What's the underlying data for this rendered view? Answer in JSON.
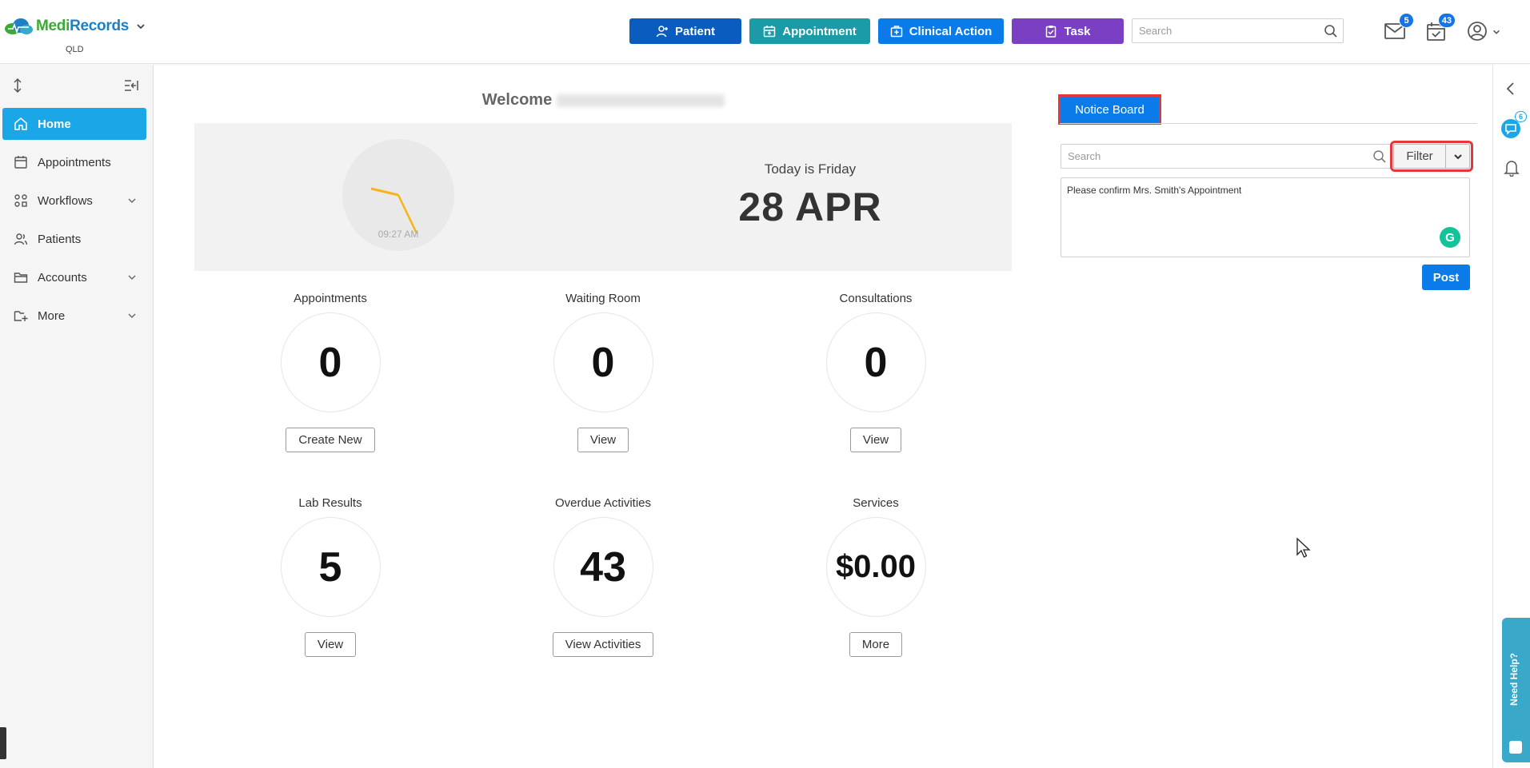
{
  "header": {
    "logo_text_a": "Medi",
    "logo_text_b": "Records",
    "location": "QLD",
    "buttons": {
      "patient": "Patient",
      "appointment": "Appointment",
      "clinical_action": "Clinical Action",
      "task": "Task"
    },
    "search_placeholder": "Search",
    "mail_badge": "5",
    "tasks_badge": "43"
  },
  "sidebar": {
    "items": [
      {
        "label": "Home",
        "icon": "home-icon"
      },
      {
        "label": "Appointments",
        "icon": "calendar-icon"
      },
      {
        "label": "Workflows",
        "icon": "workflow-icon"
      },
      {
        "label": "Patients",
        "icon": "users-icon"
      },
      {
        "label": "Accounts",
        "icon": "folder-icon"
      },
      {
        "label": "More",
        "icon": "folder-plus-icon"
      }
    ]
  },
  "dashboard": {
    "welcome": "Welcome",
    "clock_time": "09:27 AM",
    "today_label": "Today is Friday",
    "date": "28 APR",
    "stats": [
      {
        "label": "Appointments",
        "value": "0",
        "button": "Create New"
      },
      {
        "label": "Waiting Room",
        "value": "0",
        "button": "View"
      },
      {
        "label": "Consultations",
        "value": "0",
        "button": "View"
      },
      {
        "label": "Lab Results",
        "value": "5",
        "button": "View"
      },
      {
        "label": "Overdue Activities",
        "value": "43",
        "button": "View Activities"
      },
      {
        "label": "Services",
        "value": "$0.00",
        "button": "More"
      }
    ]
  },
  "notice_board": {
    "tab_label": "Notice Board",
    "search_placeholder": "Search",
    "filter_label": "Filter",
    "message": "Please confirm Mrs. Smith's Appointment",
    "post_label": "Post"
  },
  "rail": {
    "chat_badge": "6",
    "help_label": "Need Help?"
  },
  "colors": {
    "patient": "#0b5cbf",
    "appointment": "#1b9aa8",
    "clinical_action": "#0a7be8",
    "task": "#7a3fc2",
    "sidebar_active": "#1ba6e8",
    "highlight": "#e8343b"
  }
}
